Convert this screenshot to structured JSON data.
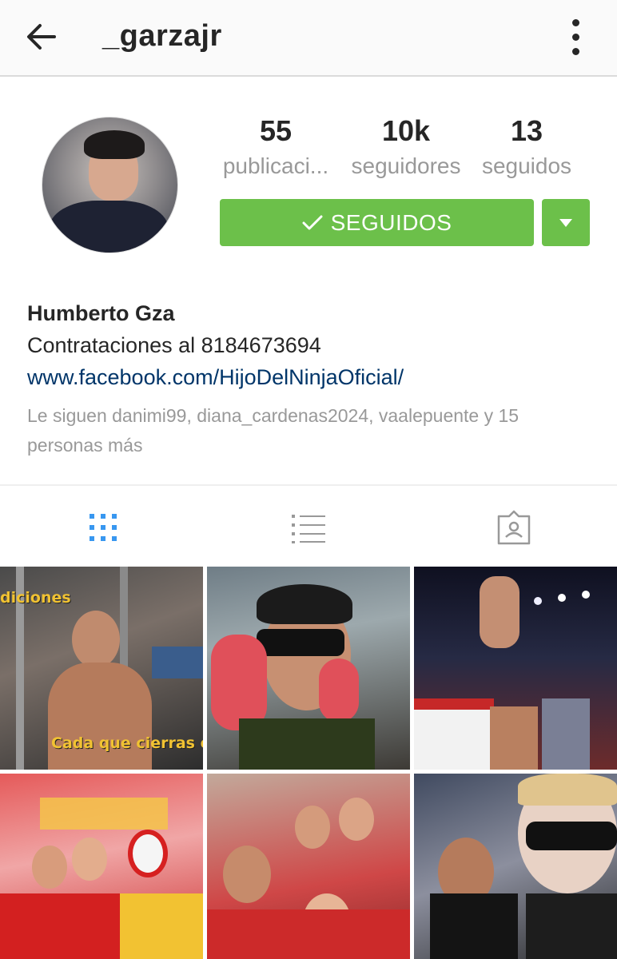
{
  "header": {
    "username": "_garzajr",
    "back_icon": "arrow-left-icon",
    "menu_icon": "more-vertical-icon"
  },
  "profile": {
    "stats": [
      {
        "value": "55",
        "label": "publicaci..."
      },
      {
        "value": "10k",
        "label": "seguidores"
      },
      {
        "value": "13",
        "label": "seguidos"
      }
    ],
    "follow_button_label": "SEGUIDOS",
    "accent_color": "#6cc04a"
  },
  "bio": {
    "name": "Humberto Gza",
    "description": "Contrataciones al 8184673694",
    "link": "www.facebook.com/HijoDelNinjaOficial/",
    "followed_by": "Le siguen danimi99, diana_cardenas2024, vaalepuente y 15 personas más"
  },
  "tabs": [
    {
      "icon": "grid-icon",
      "active": true
    },
    {
      "icon": "list-icon",
      "active": false
    },
    {
      "icon": "tagged-user-icon",
      "active": false
    }
  ],
  "grid": {
    "tile1_caption_top": "diciones",
    "tile1_caption_bottom": "Cada que cierras el p"
  }
}
